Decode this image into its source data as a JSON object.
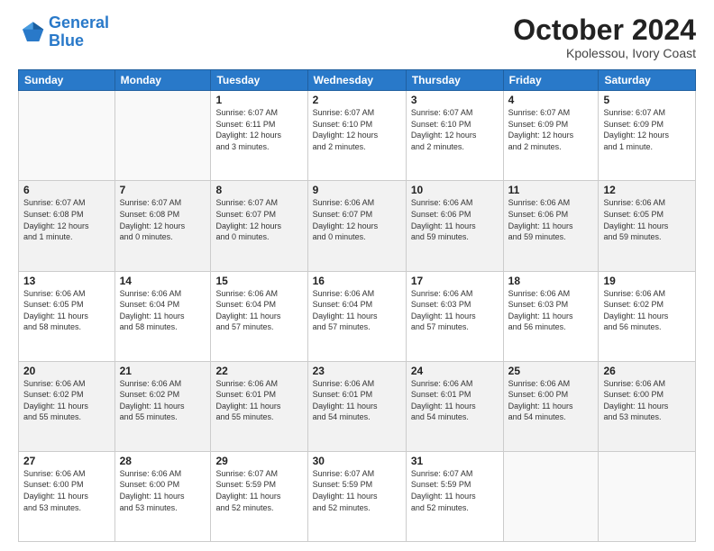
{
  "logo": {
    "line1": "General",
    "line2": "Blue"
  },
  "title": "October 2024",
  "subtitle": "Kpolessou, Ivory Coast",
  "weekdays": [
    "Sunday",
    "Monday",
    "Tuesday",
    "Wednesday",
    "Thursday",
    "Friday",
    "Saturday"
  ],
  "weeks": [
    [
      {
        "day": "",
        "info": ""
      },
      {
        "day": "",
        "info": ""
      },
      {
        "day": "1",
        "info": "Sunrise: 6:07 AM\nSunset: 6:11 PM\nDaylight: 12 hours\nand 3 minutes."
      },
      {
        "day": "2",
        "info": "Sunrise: 6:07 AM\nSunset: 6:10 PM\nDaylight: 12 hours\nand 2 minutes."
      },
      {
        "day": "3",
        "info": "Sunrise: 6:07 AM\nSunset: 6:10 PM\nDaylight: 12 hours\nand 2 minutes."
      },
      {
        "day": "4",
        "info": "Sunrise: 6:07 AM\nSunset: 6:09 PM\nDaylight: 12 hours\nand 2 minutes."
      },
      {
        "day": "5",
        "info": "Sunrise: 6:07 AM\nSunset: 6:09 PM\nDaylight: 12 hours\nand 1 minute."
      }
    ],
    [
      {
        "day": "6",
        "info": "Sunrise: 6:07 AM\nSunset: 6:08 PM\nDaylight: 12 hours\nand 1 minute."
      },
      {
        "day": "7",
        "info": "Sunrise: 6:07 AM\nSunset: 6:08 PM\nDaylight: 12 hours\nand 0 minutes."
      },
      {
        "day": "8",
        "info": "Sunrise: 6:07 AM\nSunset: 6:07 PM\nDaylight: 12 hours\nand 0 minutes."
      },
      {
        "day": "9",
        "info": "Sunrise: 6:06 AM\nSunset: 6:07 PM\nDaylight: 12 hours\nand 0 minutes."
      },
      {
        "day": "10",
        "info": "Sunrise: 6:06 AM\nSunset: 6:06 PM\nDaylight: 11 hours\nand 59 minutes."
      },
      {
        "day": "11",
        "info": "Sunrise: 6:06 AM\nSunset: 6:06 PM\nDaylight: 11 hours\nand 59 minutes."
      },
      {
        "day": "12",
        "info": "Sunrise: 6:06 AM\nSunset: 6:05 PM\nDaylight: 11 hours\nand 59 minutes."
      }
    ],
    [
      {
        "day": "13",
        "info": "Sunrise: 6:06 AM\nSunset: 6:05 PM\nDaylight: 11 hours\nand 58 minutes."
      },
      {
        "day": "14",
        "info": "Sunrise: 6:06 AM\nSunset: 6:04 PM\nDaylight: 11 hours\nand 58 minutes."
      },
      {
        "day": "15",
        "info": "Sunrise: 6:06 AM\nSunset: 6:04 PM\nDaylight: 11 hours\nand 57 minutes."
      },
      {
        "day": "16",
        "info": "Sunrise: 6:06 AM\nSunset: 6:04 PM\nDaylight: 11 hours\nand 57 minutes."
      },
      {
        "day": "17",
        "info": "Sunrise: 6:06 AM\nSunset: 6:03 PM\nDaylight: 11 hours\nand 57 minutes."
      },
      {
        "day": "18",
        "info": "Sunrise: 6:06 AM\nSunset: 6:03 PM\nDaylight: 11 hours\nand 56 minutes."
      },
      {
        "day": "19",
        "info": "Sunrise: 6:06 AM\nSunset: 6:02 PM\nDaylight: 11 hours\nand 56 minutes."
      }
    ],
    [
      {
        "day": "20",
        "info": "Sunrise: 6:06 AM\nSunset: 6:02 PM\nDaylight: 11 hours\nand 55 minutes."
      },
      {
        "day": "21",
        "info": "Sunrise: 6:06 AM\nSunset: 6:02 PM\nDaylight: 11 hours\nand 55 minutes."
      },
      {
        "day": "22",
        "info": "Sunrise: 6:06 AM\nSunset: 6:01 PM\nDaylight: 11 hours\nand 55 minutes."
      },
      {
        "day": "23",
        "info": "Sunrise: 6:06 AM\nSunset: 6:01 PM\nDaylight: 11 hours\nand 54 minutes."
      },
      {
        "day": "24",
        "info": "Sunrise: 6:06 AM\nSunset: 6:01 PM\nDaylight: 11 hours\nand 54 minutes."
      },
      {
        "day": "25",
        "info": "Sunrise: 6:06 AM\nSunset: 6:00 PM\nDaylight: 11 hours\nand 54 minutes."
      },
      {
        "day": "26",
        "info": "Sunrise: 6:06 AM\nSunset: 6:00 PM\nDaylight: 11 hours\nand 53 minutes."
      }
    ],
    [
      {
        "day": "27",
        "info": "Sunrise: 6:06 AM\nSunset: 6:00 PM\nDaylight: 11 hours\nand 53 minutes."
      },
      {
        "day": "28",
        "info": "Sunrise: 6:06 AM\nSunset: 6:00 PM\nDaylight: 11 hours\nand 53 minutes."
      },
      {
        "day": "29",
        "info": "Sunrise: 6:07 AM\nSunset: 5:59 PM\nDaylight: 11 hours\nand 52 minutes."
      },
      {
        "day": "30",
        "info": "Sunrise: 6:07 AM\nSunset: 5:59 PM\nDaylight: 11 hours\nand 52 minutes."
      },
      {
        "day": "31",
        "info": "Sunrise: 6:07 AM\nSunset: 5:59 PM\nDaylight: 11 hours\nand 52 minutes."
      },
      {
        "day": "",
        "info": ""
      },
      {
        "day": "",
        "info": ""
      }
    ]
  ]
}
